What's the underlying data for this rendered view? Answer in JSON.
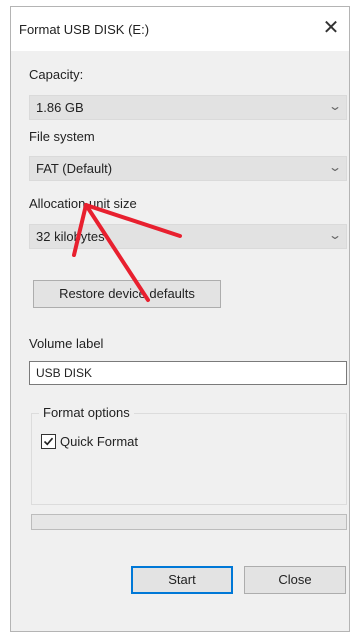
{
  "window": {
    "title": "Format USB DISK (E:)",
    "close_glyph": "✕"
  },
  "capacity": {
    "label": "Capacity:",
    "value": "1.86 GB"
  },
  "file_system": {
    "label": "File system",
    "value": "FAT (Default)"
  },
  "allocation_unit_size": {
    "label": "Allocation unit size",
    "value": "32 kilobytes"
  },
  "restore_defaults_label": "Restore device defaults",
  "volume_label": {
    "label": "Volume label",
    "value": "USB DISK"
  },
  "format_options": {
    "title": "Format options",
    "quick_format_label": "Quick Format",
    "quick_format_checked": true
  },
  "progress": {
    "fraction": 0
  },
  "buttons": {
    "start": "Start",
    "close": "Close"
  },
  "icons": {
    "dropdown": "chevron-down-icon",
    "close": "close-icon",
    "check": "checkmark-icon"
  },
  "colors": {
    "dialog_bg": "#f0f0f0",
    "combo_bg": "#e2e2e2",
    "focus_border": "#0078d7",
    "annotation_arrow": "#e8202f"
  }
}
